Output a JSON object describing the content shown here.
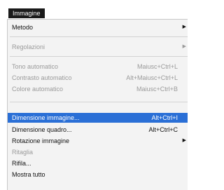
{
  "menu": {
    "title": "Immagine",
    "items": [
      {
        "label": "Metodo",
        "shortcut": "",
        "submenu": true,
        "state": "enabled"
      },
      {
        "label": "Regolazioni",
        "shortcut": "",
        "submenu": true,
        "state": "disabled"
      },
      {
        "label": "Tono automatico",
        "shortcut": "Maiusc+Ctrl+L",
        "submenu": false,
        "state": "disabled"
      },
      {
        "label": "Contrasto automatico",
        "shortcut": "Alt+Maiusc+Ctrl+L",
        "submenu": false,
        "state": "disabled"
      },
      {
        "label": "Colore automatico",
        "shortcut": "Maiusc+Ctrl+B",
        "submenu": false,
        "state": "disabled"
      },
      {
        "label": "Dimensione immagine...",
        "shortcut": "Alt+Ctrl+I",
        "submenu": false,
        "state": "selected"
      },
      {
        "label": "Dimensione quadro...",
        "shortcut": "Alt+Ctrl+C",
        "submenu": false,
        "state": "enabled"
      },
      {
        "label": "Rotazione immagine",
        "shortcut": "",
        "submenu": true,
        "state": "enabled"
      },
      {
        "label": "Ritaglia",
        "shortcut": "",
        "submenu": false,
        "state": "disabled"
      },
      {
        "label": "Rifila...",
        "shortcut": "",
        "submenu": false,
        "state": "enabled"
      },
      {
        "label": "Mostra tutto",
        "shortcut": "",
        "submenu": false,
        "state": "enabled"
      }
    ]
  },
  "colors": {
    "selection": "#2a6fd6",
    "menu_background": "#f3f3f3",
    "disabled_text": "#9a9a9a",
    "title_background": "#1a1a1a"
  },
  "icons": {
    "submenu": "chevron-right-icon"
  }
}
